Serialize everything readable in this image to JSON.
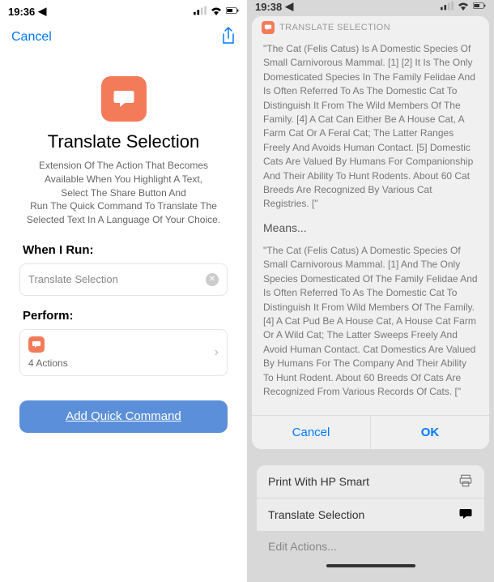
{
  "left": {
    "status": {
      "time": "19:36",
      "loc": "◀"
    },
    "nav": {
      "cancel": "Cancel"
    },
    "title": "Translate Selection",
    "desc_line1": "Extension Of The Action That Becomes",
    "desc_line2": "Available When You Highlight A Text,",
    "desc_line3": "Select The Share Button And",
    "desc_line4": "Run The Quick Command To Translate The",
    "desc_line5": "Selected Text In A Language Of Your Choice.",
    "when_label": "When I Run:",
    "when_value": "Translate Selection",
    "perform_label": "Perform:",
    "actions_count": "4 Actions",
    "add_button": "Add Quick Command"
  },
  "right": {
    "status": {
      "time": "19:38",
      "loc": "◀"
    },
    "banner": "TRANSLATE SELECTION",
    "source_text": "\"The Cat (Felis Catus) Is A Domestic Species Of Small Carnivorous Mammal. [1] [2] It Is The Only Domesticated Species In The Family Felidae And Is Often Referred To As The Domestic Cat To Distinguish It From The Wild Members Of The Family. [4] A Cat Can Either Be A House Cat, A Farm Cat Or A Feral Cat; The Latter Ranges Freely And Avoids Human Contact. [5] Domestic Cats Are Valued By Humans For Companionship And Their Ability To Hunt Rodents. About 60 Cat Breeds Are Recognized By Various Cat Registries. [\"",
    "means": "Means...",
    "translated_text": "\"The Cat (Felis Catus) A Domestic Species Of Small Carnivorous Mammal. [1] And The Only Species Domesticated Of The Family Felidae And Is Often Referred To As The Domestic Cat To Distinguish It From Wild Members Of The Family. [4] A Cat Pud Be A House Cat, A House Cat Farm Or A Wild Cat; The Latter Sweeps Freely And Avoid Human Contact. Cat Domestics Are Valued By Humans For The Company And Their Ability To Hunt Rodent. About 60 Breeds Of Cats Are Recognized From Various Records Of Cats. [\"",
    "cancel": "Cancel",
    "ok": "OK",
    "sheet": {
      "print": "Print With HP Smart",
      "translate": "Translate Selection",
      "edit": "Edit Actions..."
    }
  }
}
